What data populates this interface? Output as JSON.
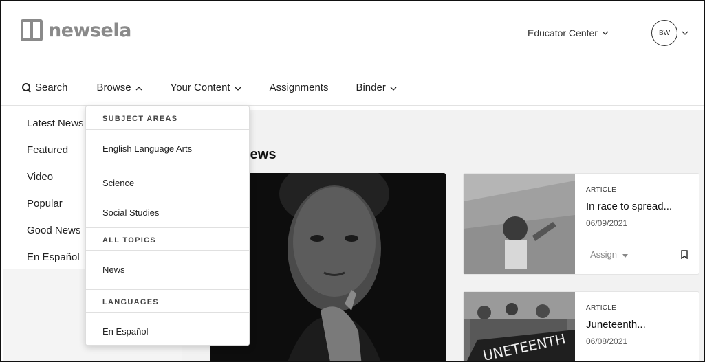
{
  "header": {
    "logo_text": "newsela",
    "educator_center": "Educator Center",
    "avatar_initials": "BW"
  },
  "nav": {
    "search": "Search",
    "browse": "Browse",
    "your_content": "Your Content",
    "assignments": "Assignments",
    "binder": "Binder"
  },
  "sidebar": {
    "items": [
      {
        "label": "Latest News"
      },
      {
        "label": "Featured"
      },
      {
        "label": "Video"
      },
      {
        "label": "Popular"
      },
      {
        "label": "Good News"
      },
      {
        "label": "En Español"
      }
    ]
  },
  "dropdown": {
    "subject_areas_heading": "SUBJECT AREAS",
    "subject_areas": [
      "English Language Arts",
      "Science",
      "Social Studies"
    ],
    "all_topics_heading": "ALL TOPICS",
    "all_topics": [
      "News"
    ],
    "languages_heading": "LANGUAGES",
    "languages": [
      "En Español"
    ]
  },
  "main": {
    "section_title_visible": "t News",
    "cards": [
      {
        "type": "ARTICLE",
        "title": "In race to spread...",
        "date": "06/09/2021",
        "assign_label": "Assign"
      },
      {
        "type": "ARTICLE",
        "title": "Juneteenth...",
        "date": "06/08/2021"
      }
    ]
  },
  "icons": {
    "search": "search-icon",
    "chevron_down": "chevron-down-icon",
    "chevron_up": "chevron-up-icon",
    "bookmark": "bookmark-icon",
    "caret": "caret-down-icon"
  }
}
